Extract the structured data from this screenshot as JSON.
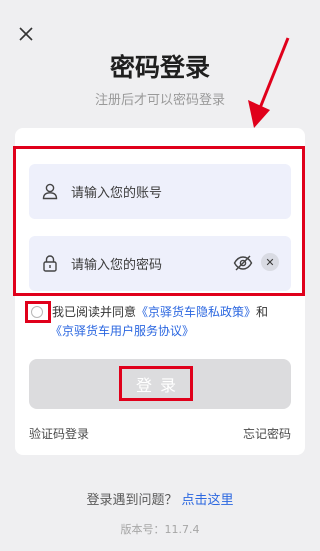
{
  "header": {
    "title": "密码登录",
    "subtitle": "注册后才可以密码登录"
  },
  "form": {
    "account_placeholder": "请输入您的账号",
    "password_placeholder": "请输入您的密码",
    "clear_label": "✕"
  },
  "agreement": {
    "prefix": "我已阅读并同意",
    "privacy_link": "《京驿货车隐私政策》",
    "conjunction": "和",
    "service_link": "《京驿货车用户服务协议》"
  },
  "actions": {
    "login_label": "登录",
    "sms_login_label": "验证码登录",
    "forgot_label": "忘记密码"
  },
  "footer": {
    "help_text": "登录遇到问题？",
    "help_link": "点击这里",
    "version": "版本号：11.7.4"
  },
  "colors": {
    "annotation": "#e0001b",
    "link": "#2b67e0",
    "button_disabled": "#dcdcde"
  }
}
